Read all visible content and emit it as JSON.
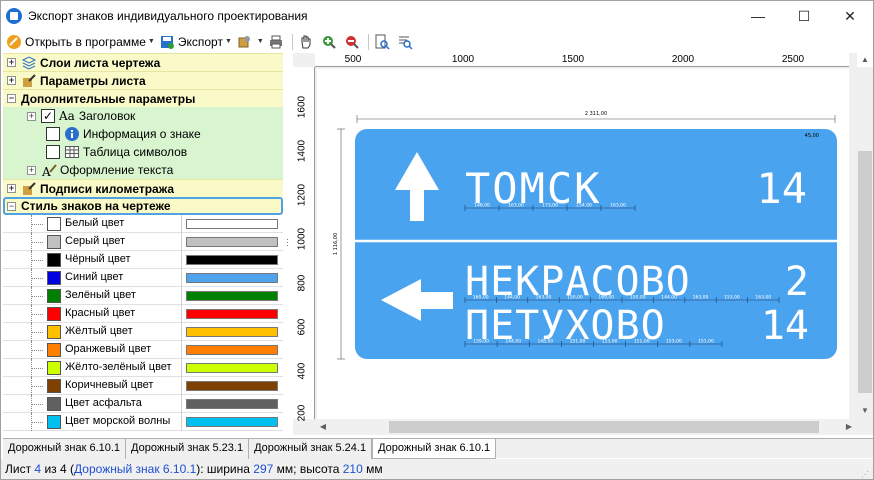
{
  "window": {
    "title": "Экспорт знаков индивидуального проектирования",
    "minimize": "—",
    "maximize": "☐",
    "close": "✕"
  },
  "toolbar": {
    "open_in_program": "Открыть в программе",
    "export": "Экспорт"
  },
  "tree": {
    "groups": {
      "sheet_layers": "Слои листа чертежа",
      "sheet_params": "Параметры листа",
      "extra_params": "Дополнительные параметры",
      "km_labels": "Подписи километража",
      "sign_style": "Стиль знаков на чертеже"
    },
    "extra_items": {
      "heading": "Заголовок",
      "sign_info": "Информация о знаке",
      "symbol_table": "Таблица символов",
      "text_design": "Оформление текста"
    },
    "colors": [
      {
        "name": "Белый цвет",
        "hex": "#ffffff"
      },
      {
        "name": "Серый цвет",
        "hex": "#c0c0c0"
      },
      {
        "name": "Чёрный цвет",
        "hex": "#000000"
      },
      {
        "name": "Синий цвет",
        "hex": "#0000e0",
        "bar": "#4da3ee"
      },
      {
        "name": "Зелёный цвет",
        "hex": "#008000"
      },
      {
        "name": "Красный цвет",
        "hex": "#ff0000"
      },
      {
        "name": "Жёлтый цвет",
        "hex": "#ffc000"
      },
      {
        "name": "Оранжевый цвет",
        "hex": "#ff8000"
      },
      {
        "name": "Жёлто-зелёный цвет",
        "hex": "#ccff00"
      },
      {
        "name": "Коричневый цвет",
        "hex": "#804000"
      },
      {
        "name": "Цвет асфальта",
        "hex": "#606060"
      },
      {
        "name": "Цвет морской волны",
        "hex": "#00c0f0"
      }
    ]
  },
  "ruler": {
    "top": [
      "500",
      "1000",
      "1500",
      "2000",
      "2500"
    ],
    "left": [
      "1600",
      "1400",
      "1200",
      "1000",
      "800",
      "600",
      "400",
      "200"
    ]
  },
  "sign": {
    "width_dim": "2 311,00",
    "height_dim": "1 116,00",
    "corner_dim": "45,00",
    "upper": {
      "city": "ТОМСК",
      "km": "14"
    },
    "lower": {
      "city1": "НЕКРАСОВО",
      "km1": "2",
      "city2": "ПЕТУХОВО",
      "km2": "14"
    },
    "dims_upper": [
      "148,00",
      "163,00",
      "173,00",
      "154,00",
      "163,00"
    ],
    "dims_mid": [
      "160,00",
      "144,00",
      "163,00",
      "150,00",
      "169,00",
      "150,00",
      "144,00",
      "163,00",
      "153,00",
      "163,00"
    ],
    "dims_low": [
      "159,00",
      "144,00",
      "148,00",
      "151,00",
      "153,00",
      "151,00",
      "153,00",
      "151,00"
    ],
    "color_blue": "#4aa3ee"
  },
  "tabs": [
    "Дорожный знак 6.10.1",
    "Дорожный знак 5.23.1",
    "Дорожный знак 5.24.1",
    "Дорожный знак 6.10.1"
  ],
  "status": {
    "sheet_word": "Лист",
    "sheet_num": "4",
    "of_word": "из",
    "sheet_total": "4",
    "sign_name": "Дорожный знак 6.10.1",
    "width_word": "): ширина",
    "width_val": "297",
    "mm1": "мм; высота",
    "height_val": "210",
    "mm2": "мм"
  }
}
